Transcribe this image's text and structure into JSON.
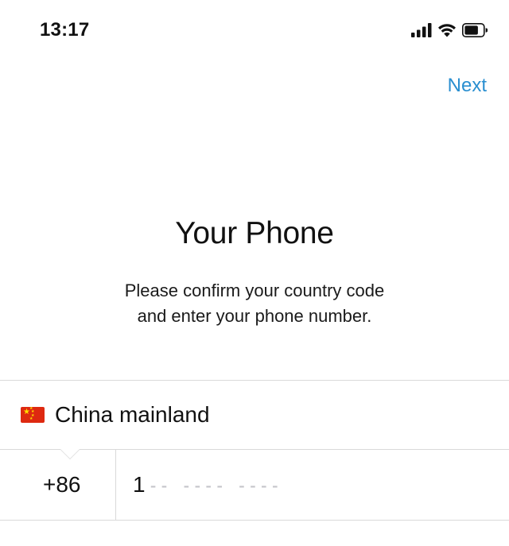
{
  "status_bar": {
    "time": "13:17",
    "icons": [
      "cellular-signal-icon",
      "wifi-icon",
      "battery-icon"
    ]
  },
  "nav": {
    "next_label": "Next"
  },
  "header": {
    "title": "Your Phone",
    "subtitle_line1": "Please confirm your country code",
    "subtitle_line2": "and enter your phone number."
  },
  "country": {
    "flag_icon": "china-flag-icon",
    "name": "China mainland"
  },
  "phone": {
    "country_code": "+86",
    "value": "1",
    "placeholder": "-- ---- ----"
  },
  "colors": {
    "accent": "#2a8fd0",
    "placeholder": "#c7c7cc",
    "divider": "#d9d9d9"
  }
}
